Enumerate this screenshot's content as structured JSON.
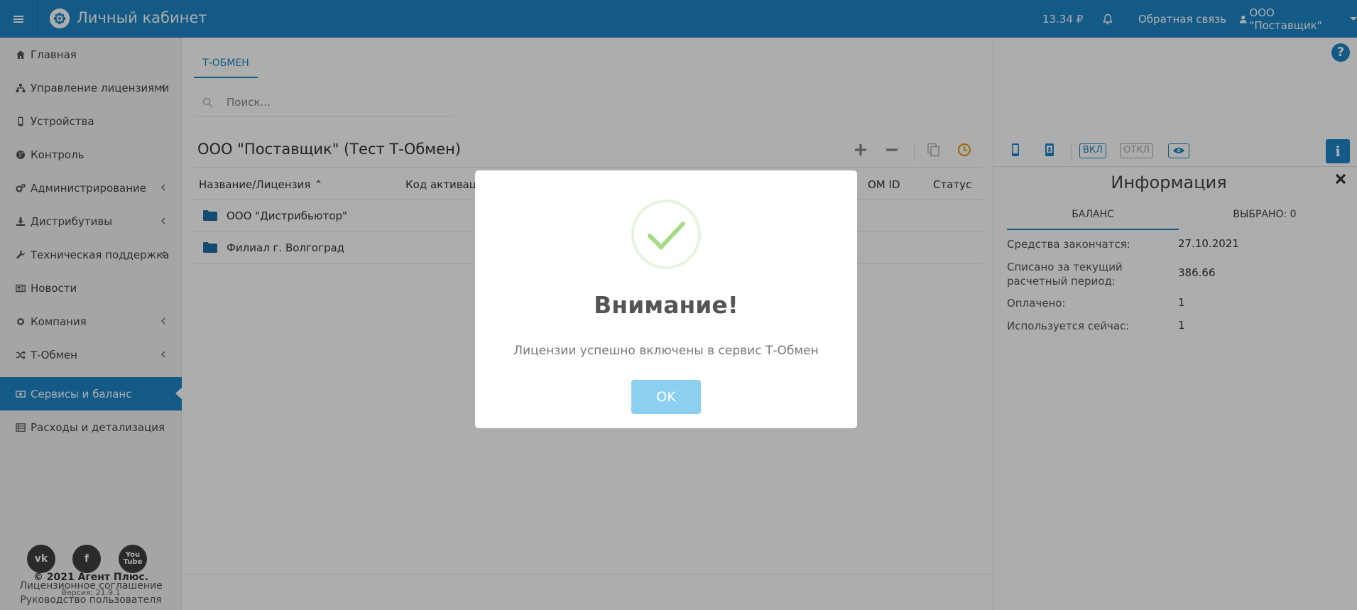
{
  "header": {
    "app_title": "Личный кабинет",
    "balance": "13.34 ₽",
    "feedback": "Обратная связь",
    "account": "ООО \"Поставщик\""
  },
  "sidebar": {
    "items": [
      {
        "label": "Главная",
        "icon": "home-icon"
      },
      {
        "label": "Управление лицензиями",
        "icon": "sitemap-icon"
      },
      {
        "label": "Устройства",
        "icon": "mobile-icon"
      },
      {
        "label": "Контроль",
        "icon": "globe-icon"
      },
      {
        "label": "Администрирование",
        "icon": "cogs-icon"
      },
      {
        "label": "Дистрибутивы",
        "icon": "download-icon"
      },
      {
        "label": "Техническая поддержка",
        "icon": "wrench-icon"
      },
      {
        "label": "Новости",
        "icon": "newspaper-icon"
      },
      {
        "label": "Компания",
        "icon": "gear-icon"
      },
      {
        "label": "Т-Обмен",
        "icon": "random-icon"
      },
      {
        "label": "Сервисы и баланс",
        "icon": "money-icon"
      },
      {
        "label": "Расходы и детализация",
        "icon": "list-icon"
      }
    ],
    "social": [
      "vk-icon",
      "facebook-icon",
      "youtube-icon"
    ],
    "license_link": "Лицензионное соглашение",
    "guide_link": "Руководство пользователя",
    "copyright": "© 2021 Агент Плюс.",
    "version": "Версия: 21.9.1"
  },
  "main": {
    "tab": "Т-ОБМЕН",
    "search_placeholder": "Поиск...",
    "org_title": "ООО \"Поставщик\" (Тест Т-Обмен)",
    "columns": {
      "name": "Название/Лицензия",
      "activation": "Код активации",
      "om_id": "OM ID",
      "status": "Статус"
    },
    "rows": [
      {
        "name": "ООО \"Дистрибьютор\""
      },
      {
        "name": "Филиал г. Волгоград"
      }
    ]
  },
  "panel": {
    "pill_on": "ВКЛ",
    "pill_off": "ОТКЛ",
    "title": "Информация",
    "tab_balance": "БАЛАНС",
    "tab_selected": "ВЫБРАНО: 0",
    "rows": [
      {
        "label": "Средства закончатся:",
        "value": "27.10.2021"
      },
      {
        "label": "Списано за текущий расчетный период:",
        "value": "386.66"
      },
      {
        "label": "Оплачено:",
        "value": "1"
      },
      {
        "label": "Используется сейчас:",
        "value": "1"
      }
    ]
  },
  "modal": {
    "title": "Внимание!",
    "message": "Лицензии успешно включены в сервис Т-Обмен",
    "ok": "OK"
  },
  "colors": {
    "primary": "#1e85c8",
    "success": "#a5dc86",
    "warning": "#e8a317"
  }
}
